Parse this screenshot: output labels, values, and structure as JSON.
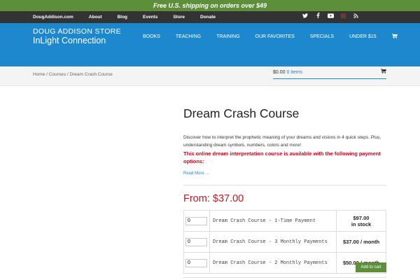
{
  "promo": {
    "text": "Free U.S. shipping on orders over $49"
  },
  "util_nav": {
    "links": [
      "DougAddison.com",
      "About",
      "Blog",
      "Events",
      "Store",
      "Donate"
    ]
  },
  "social": [
    "twitter-icon",
    "facebook-icon",
    "youtube-icon",
    "instagram-icon",
    "rss-icon"
  ],
  "brand": {
    "store": "DOUG ADDISON STORE",
    "tagline": "InLight Connection"
  },
  "main_nav": {
    "links": [
      "BOOKS",
      "TEACHING",
      "TRAINING",
      "OUR FAVORITES",
      "SPECIALS",
      "UNDER $15"
    ],
    "cart_icon": "shopping-cart-icon"
  },
  "breadcrumb": {
    "home": "Home",
    "sep1": " / ",
    "courses": "Courses",
    "sep2": " / ",
    "current": "Dream Crash Course"
  },
  "mini_cart": {
    "amount": "$0.00",
    "items": "0 items",
    "icon": "shopping-bag-icon"
  },
  "product": {
    "title": "Dream Crash Course",
    "description": "Discover how to interpret the prophetic meaning of your dreams and visions in 4 quick steps. Plus, understanding dream symbols, numbers, colors and more!",
    "highlight": "This online dream interpretation course is available with the following payment options:",
    "read_more": "Read More →",
    "price_label": "From: $37.00",
    "options": [
      {
        "qty": "0",
        "name": "Dream Crash Course - 1-Time Payment",
        "price": "$97.00",
        "stock": "in stock"
      },
      {
        "qty": "0",
        "name": "Dream Crash Course - 3 Monthly Payments",
        "price": "$37.00 / month",
        "stock": ""
      },
      {
        "qty": "0",
        "name": "Dream Crash Course - 2 Monthly Payments",
        "price": "$50.00 / month",
        "stock": ""
      }
    ],
    "add_to_cart": "Add to cart"
  },
  "colors": {
    "brand_blue": "#1e88cf",
    "promo_green": "#5d8f3b",
    "price_red": "#c1161c",
    "highlight_red": "#d0021b"
  }
}
